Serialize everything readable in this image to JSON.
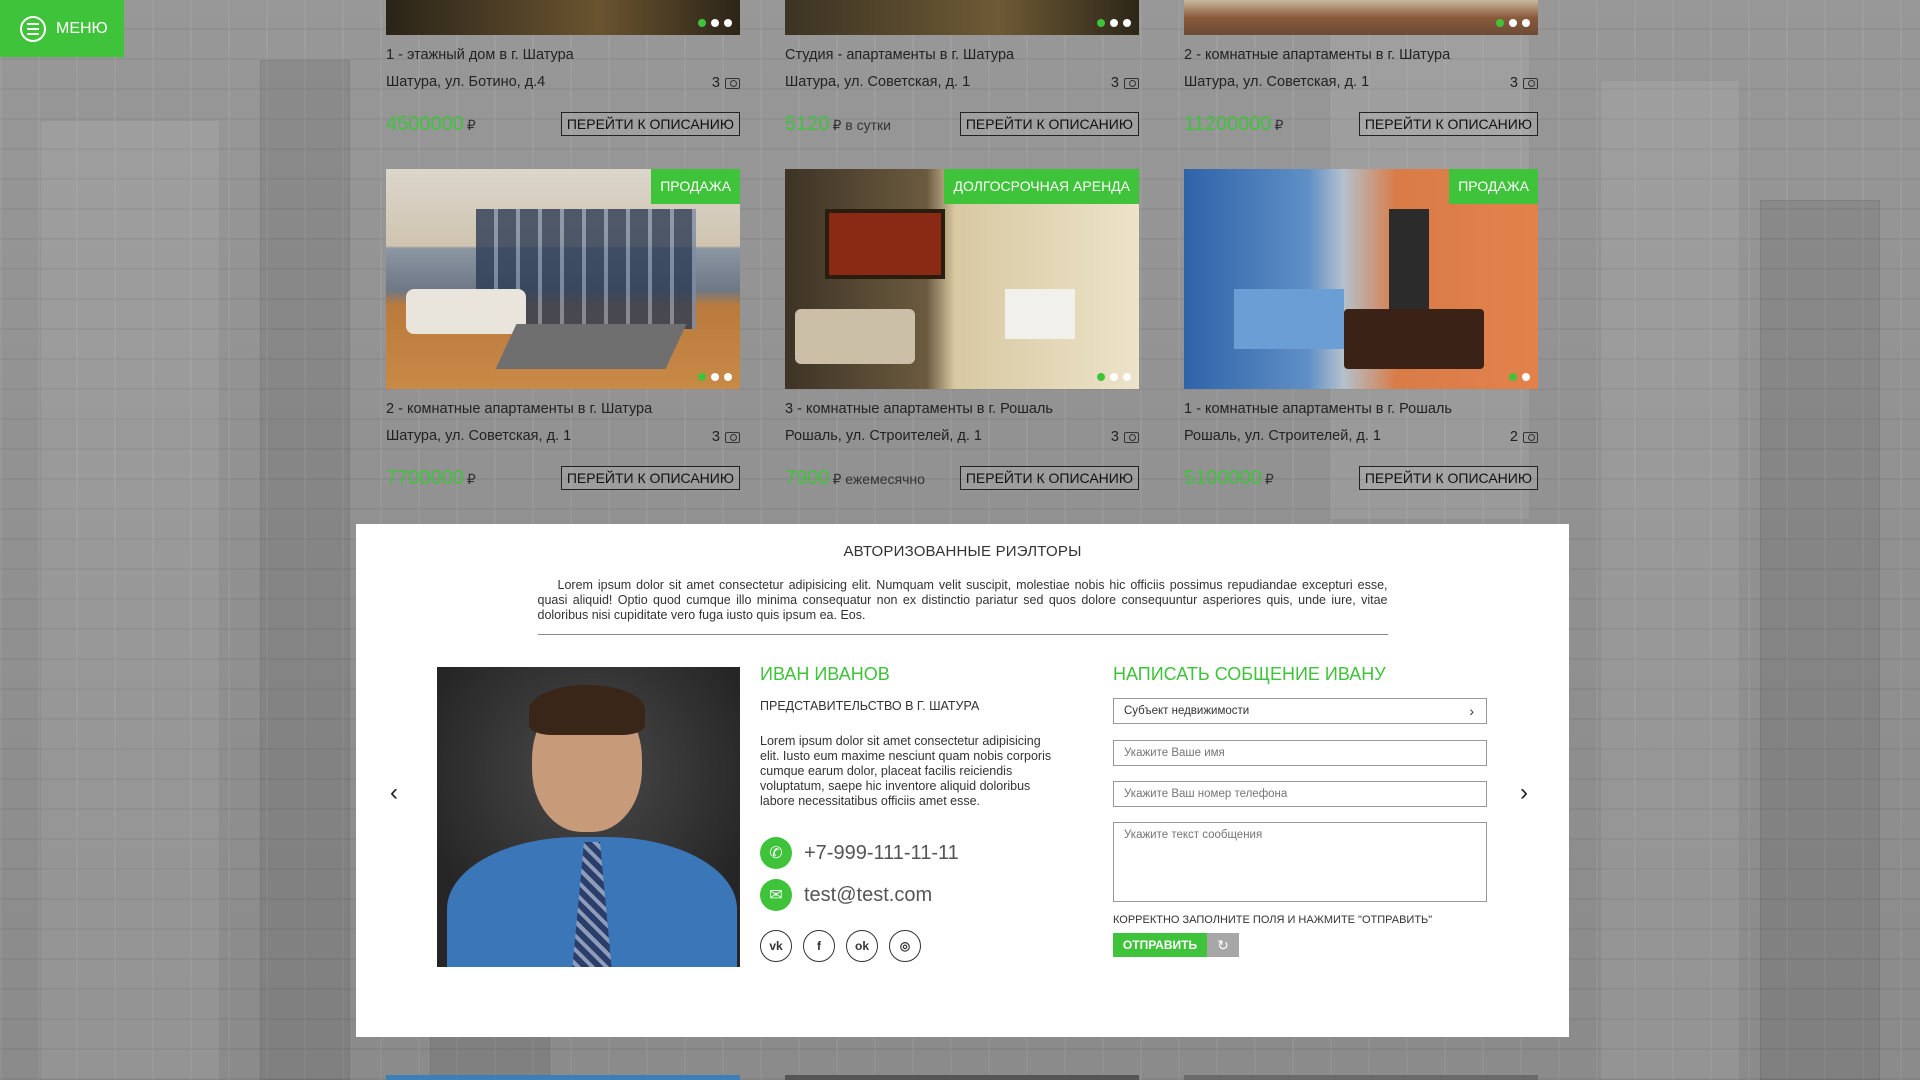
{
  "menu": {
    "label": "МЕНЮ",
    "icon": "hamburger-icon"
  },
  "top_listings": [
    {
      "title": "1 - этажный дом в г. Шатура",
      "address": "Шатура, ул. Ботино, д.4",
      "photo_count": "3",
      "price": "4500000",
      "price_suffix": "₽",
      "button": "ПЕРЕЙТИ К ОПИСАНИЮ"
    },
    {
      "title": "Студия - апартаменты в г. Шатура",
      "address": "Шатура, ул. Советская, д. 1",
      "photo_count": "3",
      "price": "5120",
      "price_suffix": "₽ в сутки",
      "button": "ПЕРЕЙТИ К ОПИСАНИЮ"
    },
    {
      "title": "2 - комнатные апартаменты в г. Шатура",
      "address": "Шатура, ул. Советская, д. 1",
      "photo_count": "3",
      "price": "11200000",
      "price_suffix": "₽",
      "button": "ПЕРЕЙТИ К ОПИСАНИЮ"
    }
  ],
  "listings": [
    {
      "badge": "ПРОДАЖА",
      "title": "2 - комнатные апартаменты в г. Шатура",
      "address": "Шатура, ул. Советская, д. 1",
      "photo_count": "3",
      "price": "7700000",
      "price_suffix": "₽",
      "button": "ПЕРЕЙТИ К ОПИСАНИЮ"
    },
    {
      "badge": "ДОЛГОСРОЧНАЯ АРЕНДА",
      "title": "3 - комнатные апартаменты в г. Рошаль",
      "address": "Рошаль, ул. Строителей, д. 1",
      "photo_count": "3",
      "price": "7900",
      "price_suffix": "₽ ежемесячно",
      "button": "ПЕРЕЙТИ К ОПИСАНИЮ"
    },
    {
      "badge": "ПРОДАЖА",
      "title": "1 - комнатные апартаменты в г. Рошаль",
      "address": "Рошаль, ул. Строителей, д. 1",
      "photo_count": "2",
      "price": "5100000",
      "price_suffix": "₽",
      "button": "ПЕРЕЙТИ К ОПИСАНИЮ"
    }
  ],
  "realtors": {
    "heading": "АВТОРИЗОВАННЫЕ РИЭЛТОРЫ",
    "intro": "Lorem ipsum dolor sit amet consectetur adipisicing elit. Numquam velit suscipit, molestiae nobis hic officiis possimus repudiandae excepturi esse, quasi aliquid! Optio quod cumque illo minima consequatur non ex distinctio pariatur sed quos dolore consequuntur asperiores quis, unde iure, vitae doloribus nisi cupiditate vero fuga iusto quis ipsum ea. Eos.",
    "agent": {
      "name": "ИВАН ИВАНОВ",
      "office": "ПРЕДСТАВИТЕЛЬСТВО В Г. ШАТУРА",
      "bio": "Lorem ipsum dolor sit amet consectetur adipisicing elit. Iusto eum maxime nesciunt quam nobis corporis cumque earum dolor, placeat facilis reiciendis voluptatum, saepe hic inventore aliquid doloribus labore necessitatibus officiis amet esse.",
      "phone": "+7-999-111-11-11",
      "email": "test@test.com",
      "socials": [
        "vk-icon",
        "facebook-icon",
        "odnoklassniki-icon",
        "instagram-icon"
      ]
    },
    "form": {
      "title": "НАПИСАТЬ СОБЩЕНИЕ ИВАНУ",
      "subject_placeholder": "Субъект недвижимости",
      "name_placeholder": "Укажите Ваше имя",
      "phone_placeholder": "Укажите Ваш номер телефона",
      "message_placeholder": "Укажите текст сообщения",
      "hint": "КОРРЕКТНО ЗАПОЛНИТЕ ПОЛЯ И НАЖМИТЕ \"ОТПРАВИТЬ\"",
      "submit": "ОТПРАВИТЬ"
    }
  },
  "colors": {
    "accent": "#3fc33a",
    "panel": "#ffffff"
  }
}
